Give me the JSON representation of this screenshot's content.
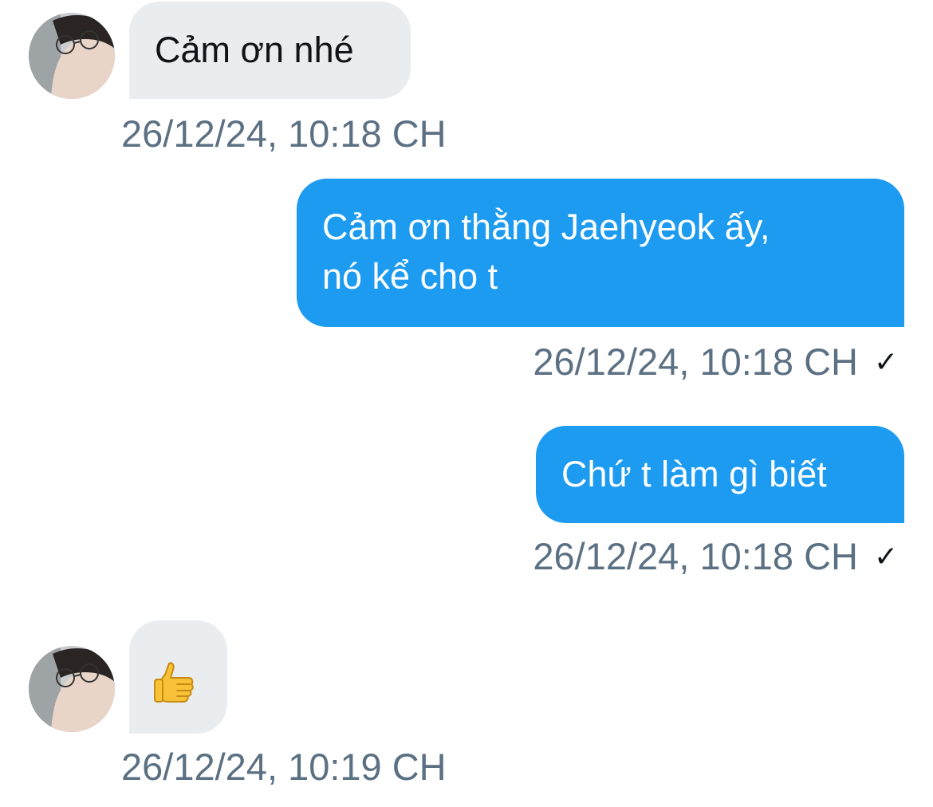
{
  "messages": [
    {
      "direction": "in",
      "text": "Cảm ơn nhé",
      "timestamp": "26/12/24, 10:18 CH"
    },
    {
      "direction": "out",
      "text": "Cảm ơn thằng Jaehyeok ấy,\nnó kể cho t",
      "timestamp": "26/12/24, 10:18 CH",
      "status_icon": "check-icon"
    },
    {
      "direction": "out",
      "text": "Chứ t làm gì biết",
      "timestamp": "26/12/24, 10:18 CH",
      "status_icon": "check-icon"
    },
    {
      "direction": "in",
      "emoji": "thumbs-up-icon",
      "timestamp": "26/12/24, 10:19 CH"
    }
  ],
  "colors": {
    "incoming_bubble": "#e9edf0",
    "outgoing_bubble": "#1d9bf0",
    "timestamp_text": "#5b7083"
  }
}
